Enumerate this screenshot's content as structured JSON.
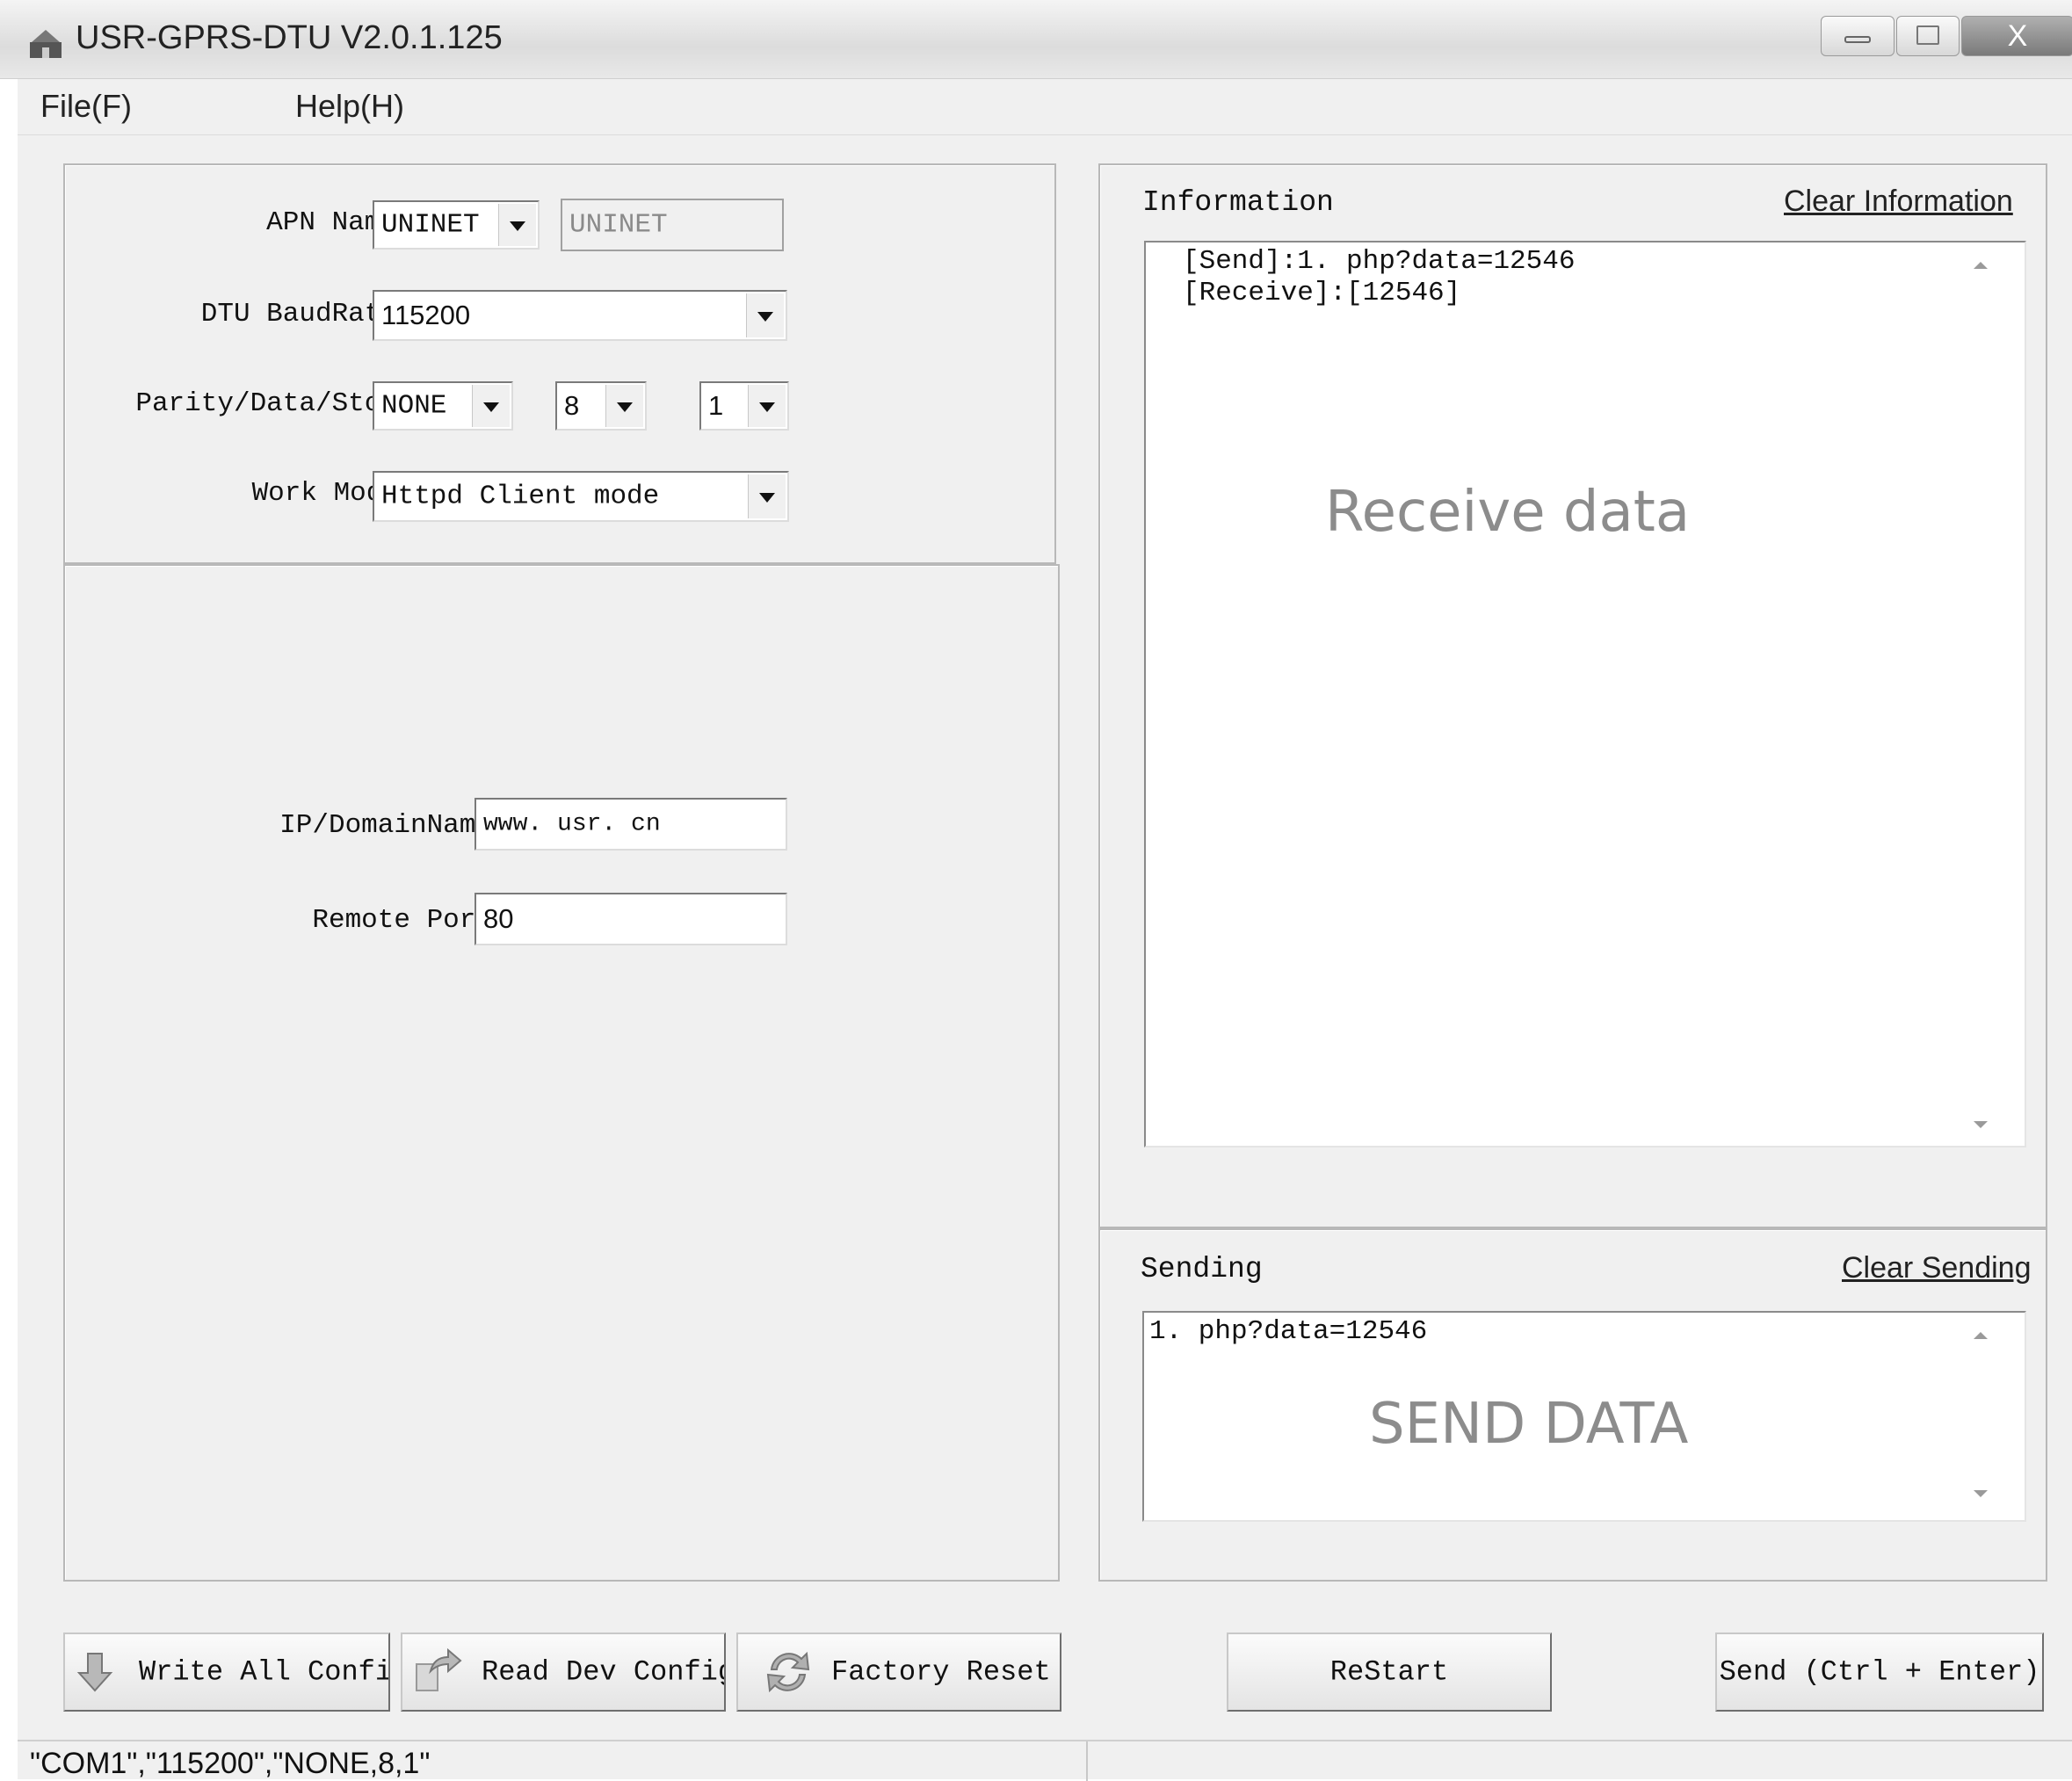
{
  "window": {
    "title": "USR-GPRS-DTU V2.0.1.125",
    "close_glyph": "X"
  },
  "menu": {
    "file": "File(F)",
    "help": "Help(H)"
  },
  "config": {
    "apn_label": "APN Name",
    "apn_select": "UNINET",
    "apn_text": "UNINET",
    "baud_label": "DTU BaudRate",
    "baud_value": "115200",
    "pds_label": "Parity/Data/Stop",
    "parity": "NONE",
    "data_bits": "8",
    "stop_bits": "1",
    "workmode_label": "Work Mode",
    "workmode_value": "Httpd Client mode",
    "ip_label": "IP/DomainName",
    "ip_value": "www. usr. cn",
    "port_label": "Remote Port",
    "port_value": "80"
  },
  "information": {
    "header": "Information",
    "clear_link": "Clear Information",
    "lines": [
      "[Send]:1. php?data=12546",
      "[Receive]:[12546]"
    ],
    "watermark": "Receive data"
  },
  "sending": {
    "header": "Sending",
    "clear_link": "Clear Sending",
    "text": "1. php?data=12546",
    "watermark": "SEND DATA"
  },
  "buttons": {
    "write_all": "Write All Config",
    "read_dev": "Read Dev Config",
    "factory_reset": "Factory Reset",
    "restart": "ReStart",
    "send": "Send (Ctrl + Enter)"
  },
  "status": {
    "text": "\"COM1\",\"115200\",\"NONE,8,1\""
  },
  "colors": {
    "window_bg": "#f0f0f0",
    "field_bg": "#ffffff",
    "watermark": "#8c8c8c"
  }
}
